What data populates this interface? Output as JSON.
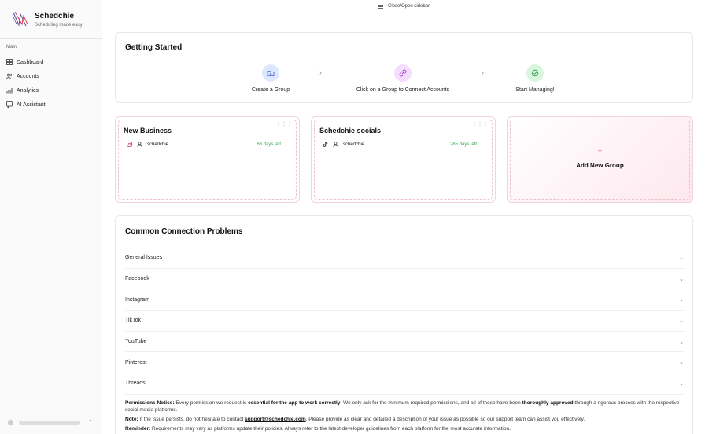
{
  "brand": {
    "name": "Schedchie",
    "tagline": "Scheduling made easy"
  },
  "sidebar": {
    "section_label": "Main",
    "items": [
      {
        "label": "Dashboard",
        "icon": "dashboard-icon"
      },
      {
        "label": "Accounts",
        "icon": "users-icon"
      },
      {
        "label": "Analytics",
        "icon": "bar-chart-icon"
      },
      {
        "label": "AI Assistant",
        "icon": "chat-icon"
      }
    ]
  },
  "topbar": {
    "toggle_label": "Close/Open sidebar"
  },
  "getting_started": {
    "title": "Getting Started",
    "steps": [
      {
        "label": "Create a Group",
        "icon": "folder-plus-icon",
        "color": "#dbe6ff"
      },
      {
        "label": "Click on a Group to Connect Accounts",
        "icon": "link-icon",
        "color": "#f5dcff"
      },
      {
        "label": "Start Managing!",
        "icon": "check-circle-icon",
        "color": "#d9f5de"
      }
    ]
  },
  "groups": [
    {
      "title": "New Business",
      "platform_icon": "instagram-icon",
      "account": "schedchie",
      "days_left": "83 days left"
    },
    {
      "title": "Schedchie socials",
      "platform_icon": "tiktok-icon",
      "account": "schedchie",
      "days_left": "285 days left"
    }
  ],
  "add_group": {
    "plus": "+",
    "label": "Add New Group"
  },
  "problems": {
    "title": "Common Connection Problems",
    "items": [
      "General Issues",
      "Facebook",
      "Instagram",
      "TikTok",
      "YouTube",
      "Pinterest",
      "Threads"
    ],
    "notes": {
      "permissions_label": "Permissions Notice:",
      "permissions_1": "Every permission we request is",
      "permissions_bold_1": "essential for the app to work correctly",
      "permissions_2": ". We only ask for the minimum required permissions, and all of these have been",
      "permissions_bold_2": "thoroughly approved",
      "permissions_3": "through a rigorous process with the respective social media platforms.",
      "note_label": "Note:",
      "note_1": "If the issue persists, do not hesitate to contact",
      "note_email": "support@schedchie.com",
      "note_2": ". Please provide as clear and detailed a description of your issue as possible so our support team can assist you effectively.",
      "reminder_label": "Reminder:",
      "reminder_text": "Requirements may vary as platforms update their policies. Always refer to the latest developer guidelines from each platform for the most accurate information."
    }
  },
  "colors": {
    "accent_green": "#2fa64b",
    "accent_pink": "#ecc3cb"
  }
}
